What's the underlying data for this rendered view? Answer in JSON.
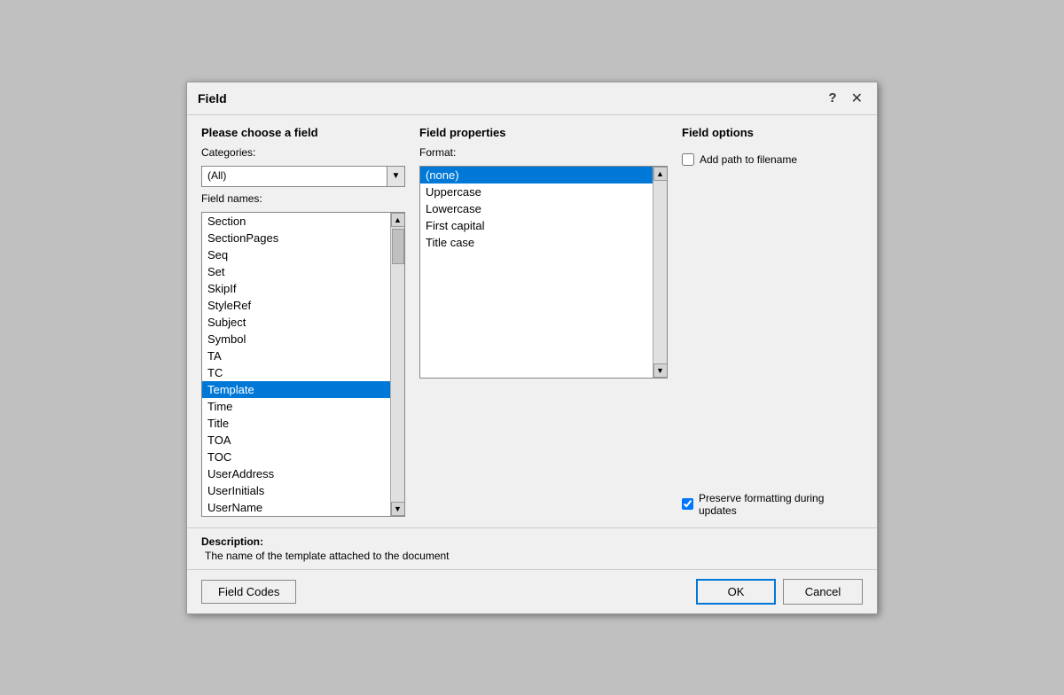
{
  "dialog": {
    "title": "Field",
    "help_label": "?",
    "close_label": "✕"
  },
  "left_panel": {
    "section_title": "Please choose a field",
    "categories_label": "Categories:",
    "categories_value": "(All)",
    "field_names_label": "Field names:",
    "field_names": [
      "Section",
      "SectionPages",
      "Seq",
      "Set",
      "SkipIf",
      "StyleRef",
      "Subject",
      "Symbol",
      "TA",
      "TC",
      "Template",
      "Time",
      "Title",
      "TOA",
      "TOC",
      "UserAddress",
      "UserInitials",
      "UserName"
    ],
    "selected_field": "Template"
  },
  "middle_panel": {
    "title": "Field properties",
    "format_label": "Format:",
    "format_options": [
      "(none)",
      "Uppercase",
      "Lowercase",
      "First capital",
      "Title case"
    ],
    "selected_format": "(none)"
  },
  "right_panel": {
    "title": "Field options",
    "add_path_label": "Add path to filename",
    "preserve_label": "Preserve formatting during updates",
    "preserve_checked": true,
    "add_path_checked": false
  },
  "description": {
    "label": "Description:",
    "text": "The name of the template attached to the document"
  },
  "footer": {
    "field_codes_label": "Field Codes",
    "ok_label": "OK",
    "cancel_label": "Cancel"
  }
}
